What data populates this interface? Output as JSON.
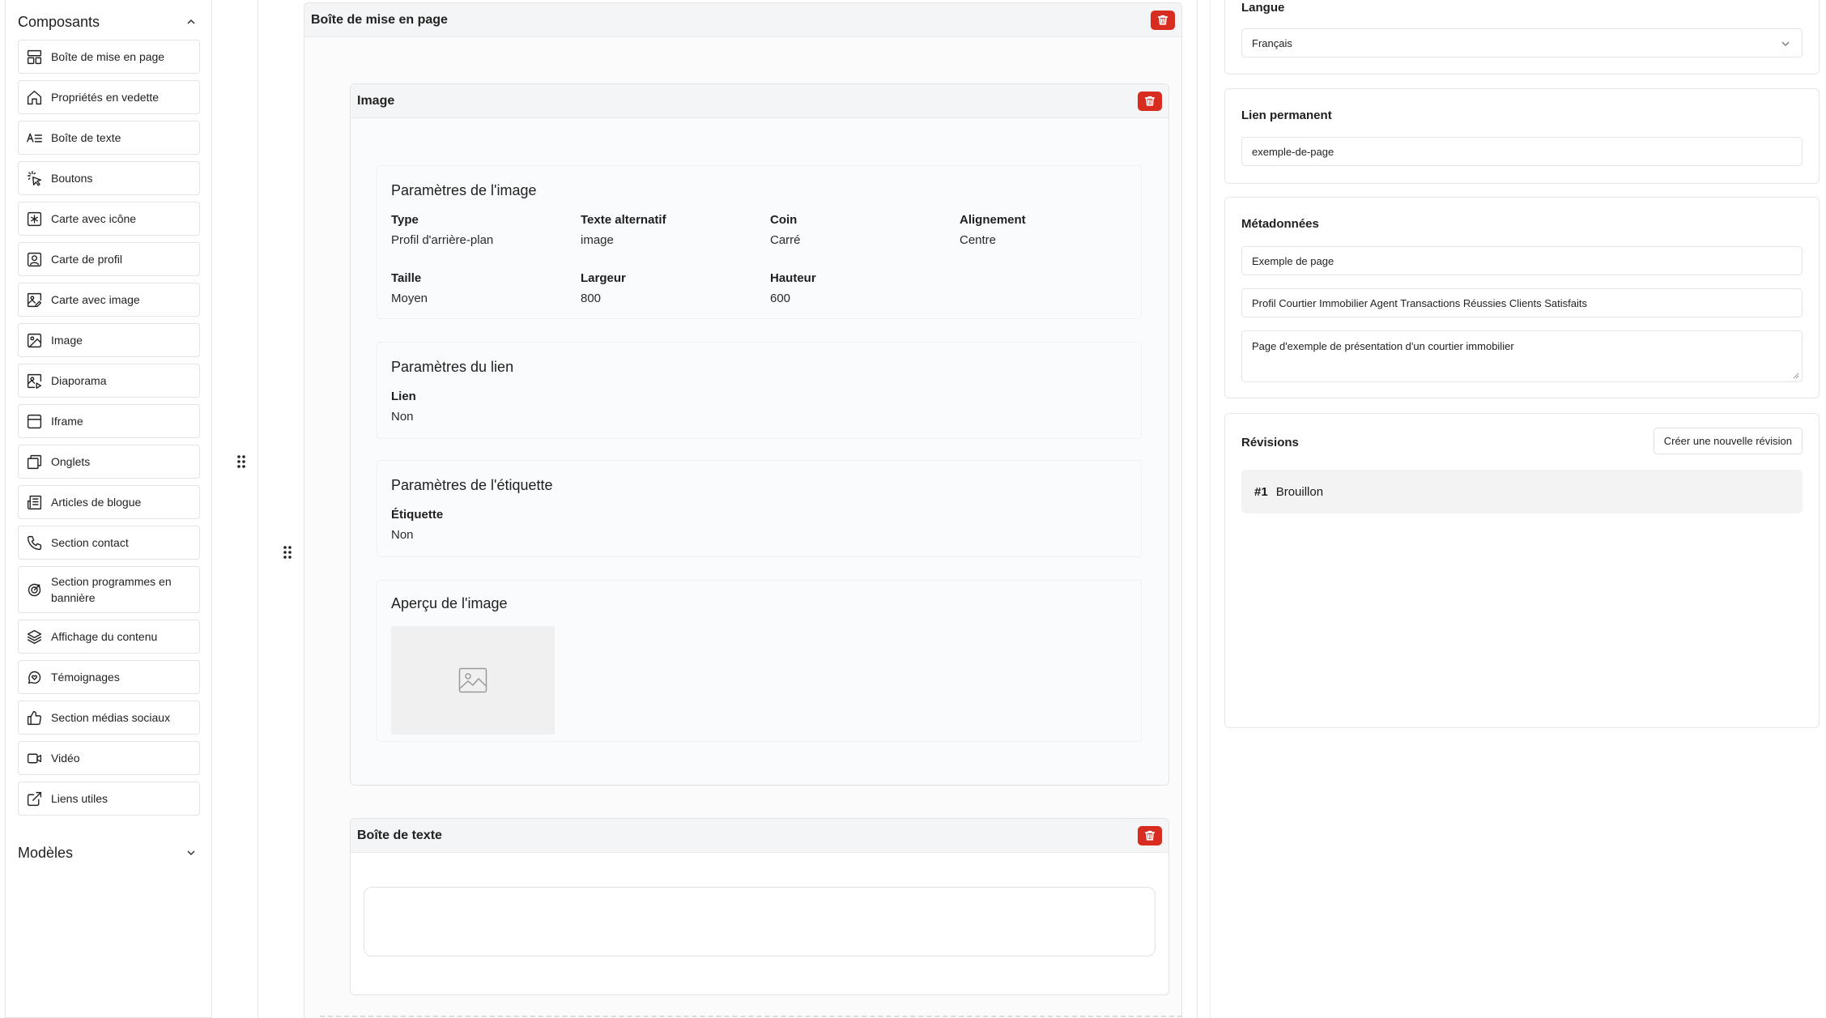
{
  "sidebar": {
    "components_title": "Composants",
    "models_title": "Modèles",
    "items": [
      {
        "label": "Boîte de mise en page",
        "icon": "layout-icon"
      },
      {
        "label": "Propriétés en vedette",
        "icon": "home-icon"
      },
      {
        "label": "Boîte de texte",
        "icon": "text-icon"
      },
      {
        "label": "Boutons",
        "icon": "pointer-click-icon"
      },
      {
        "label": "Carte avec icône",
        "icon": "star-square-icon"
      },
      {
        "label": "Carte de profil",
        "icon": "profile-square-icon"
      },
      {
        "label": "Carte avec image",
        "icon": "image-edit-icon"
      },
      {
        "label": "Image",
        "icon": "image-icon"
      },
      {
        "label": "Diaporama",
        "icon": "slideshow-icon"
      },
      {
        "label": "Iframe",
        "icon": "browser-icon"
      },
      {
        "label": "Onglets",
        "icon": "tabs-icon"
      },
      {
        "label": "Articles de blogue",
        "icon": "newspaper-icon"
      },
      {
        "label": "Section contact",
        "icon": "phone-icon"
      },
      {
        "label": "Section programmes en bannière",
        "icon": "target-icon"
      },
      {
        "label": "Affichage du contenu",
        "icon": "layers-icon"
      },
      {
        "label": "Témoignages",
        "icon": "chat-heart-icon"
      },
      {
        "label": "Section médias sociaux",
        "icon": "thumbs-up-icon"
      },
      {
        "label": "Vidéo",
        "icon": "video-icon"
      },
      {
        "label": "Liens utiles",
        "icon": "external-link-icon"
      }
    ]
  },
  "canvas": {
    "layout_box_title": "Boîte de mise en page",
    "image_block": {
      "title": "Image",
      "image_settings": {
        "title": "Paramètres de l'image",
        "type_label": "Type",
        "type_value": "Profil d'arrière-plan",
        "alt_label": "Texte alternatif",
        "alt_value": "image",
        "corner_label": "Coin",
        "corner_value": "Carré",
        "align_label": "Alignement",
        "align_value": "Centre",
        "size_label": "Taille",
        "size_value": "Moyen",
        "width_label": "Largeur",
        "width_value": "800",
        "height_label": "Hauteur",
        "height_value": "600"
      },
      "link_settings": {
        "title": "Paramètres du lien",
        "link_label": "Lien",
        "link_value": "Non"
      },
      "label_settings": {
        "title": "Paramètres de l'étiquette",
        "label_label": "Étiquette",
        "label_value": "Non"
      },
      "preview": {
        "title": "Aperçu de l'image"
      }
    },
    "text_block": {
      "title": "Boîte de texte"
    }
  },
  "right": {
    "language": {
      "title": "Langue",
      "value": "Français"
    },
    "permalink": {
      "title": "Lien permanent",
      "value": "exemple-de-page"
    },
    "metadata": {
      "title": "Métadonnées",
      "page_title": "Exemple de page",
      "keywords": "Profil Courtier Immobilier Agent Transactions Réussies Clients Satisfaits",
      "description": "Page d'exemple de présentation d'un courtier immobilier"
    },
    "revisions": {
      "title": "Révisions",
      "new_button": "Créer une nouvelle révision",
      "items": [
        {
          "number": "#1",
          "label": "Brouillon"
        }
      ]
    }
  },
  "colors": {
    "danger": "#d92c20",
    "border": "#e3e3e3",
    "panel_bg": "#fafbfc"
  }
}
